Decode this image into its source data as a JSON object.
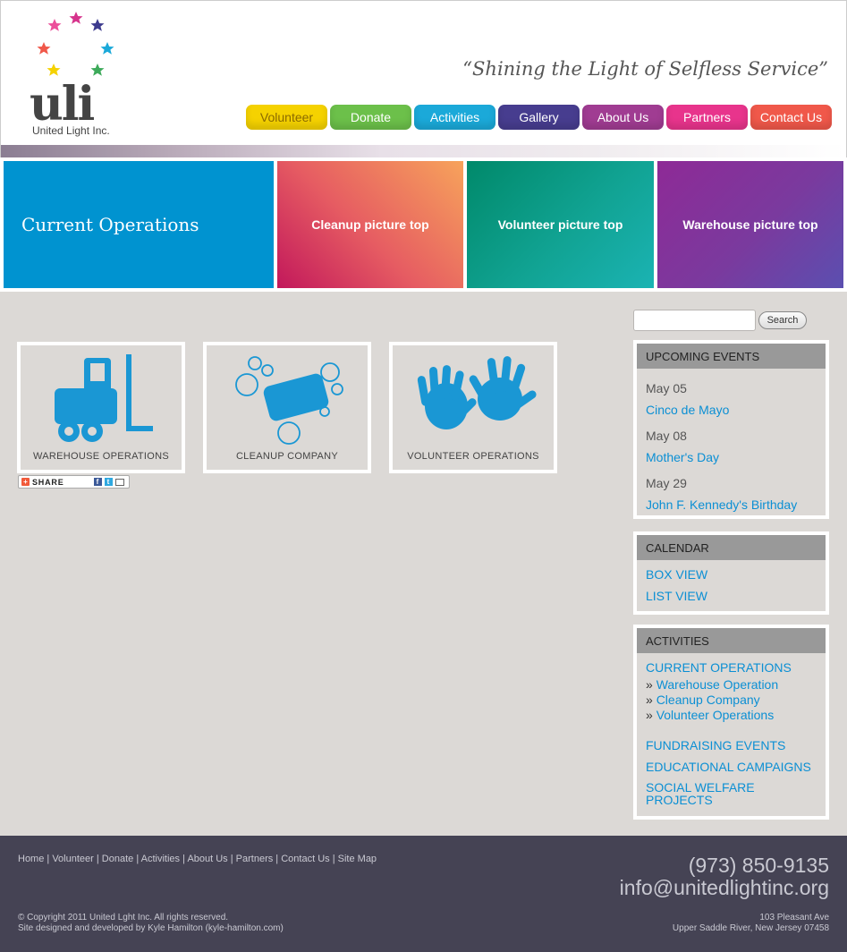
{
  "header": {
    "logo_text": "uli",
    "logo_subtitle": "United Light Inc.",
    "tagline": "“Shining the Light of Selfless Service”",
    "nav": [
      {
        "label": "Volunteer",
        "color": "#f5d200",
        "text_color": "#8a6a00"
      },
      {
        "label": "Donate",
        "color": "#6cc04a",
        "text_color": "#ffffff"
      },
      {
        "label": "Activities",
        "color": "#1ba9d9",
        "text_color": "#ffffff"
      },
      {
        "label": "Gallery",
        "color": "#473d8f",
        "text_color": "#ffffff"
      },
      {
        "label": "About Us",
        "color": "#a03c92",
        "text_color": "#ffffff"
      },
      {
        "label": "Partners",
        "color": "#e8348c",
        "text_color": "#ffffff"
      },
      {
        "label": "Contact Us",
        "color": "#f0584a",
        "text_color": "#ffffff"
      }
    ]
  },
  "banner": {
    "main": "Current Operations",
    "tiles": [
      "Cleanup picture top",
      "Volunteer picture top",
      "Warehouse picture top"
    ]
  },
  "operations": [
    {
      "label": "WAREHOUSE OPERATIONS",
      "icon": "forklift-icon"
    },
    {
      "label": "CLEANUP COMPANY",
      "icon": "soap-bubbles-icon"
    },
    {
      "label": "VOLUNTEER OPERATIONS",
      "icon": "hands-icon"
    }
  ],
  "share": {
    "label": "SHARE"
  },
  "sidebar": {
    "search_placeholder": "",
    "search_button": "Search",
    "upcoming": {
      "heading": "UPCOMING EVENTS",
      "events": [
        {
          "date": "May 05",
          "title": "Cinco de Mayo"
        },
        {
          "date": "May 08",
          "title": "Mother's Day"
        },
        {
          "date": "May 29",
          "title": "John F. Kennedy's Birthday"
        }
      ]
    },
    "calendar": {
      "heading": "CALENDAR",
      "links": [
        "BOX VIEW",
        "LIST VIEW"
      ]
    },
    "activities": {
      "heading": "ACTIVITIES",
      "current": "CURRENT OPERATIONS",
      "sub": [
        "Warehouse Operation",
        "Cleanup Company",
        "Volunteer Operations"
      ],
      "links": [
        "FUNDRAISING EVENTS",
        "EDUCATIONAL CAMPAIGNS",
        "SOCIAL WELFARE PROJECTS"
      ]
    }
  },
  "footer": {
    "nav": [
      "Home",
      "Volunteer",
      "Donate",
      "Activities",
      "About Us",
      "Partners",
      "Contact Us",
      "Site Map"
    ],
    "phone": "(973) 850-9135",
    "email": "info@unitedlightinc.org",
    "copyright": "© Copyright 2011 United Lght Inc. All rights reserved.",
    "credit": "Site designed and developed by Kyle Hamilton (kyle-hamilton.com)",
    "address_line1": "103 Pleasant Ave",
    "address_line2": "Upper Saddle River, New Jersey 07458"
  }
}
